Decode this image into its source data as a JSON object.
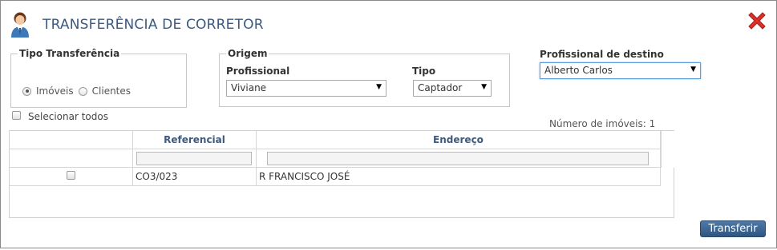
{
  "title": "TRANSFERÊNCIA DE CORRETOR",
  "tipo_transferencia": {
    "legend": "Tipo Transferência",
    "options": [
      "Imóveis",
      "Clientes"
    ],
    "selected": "Imóveis"
  },
  "origem": {
    "legend": "Origem",
    "profissional_label": "Profissional",
    "profissional_value": "Viviane",
    "tipo_label": "Tipo",
    "tipo_value": "Captador"
  },
  "destino": {
    "label": "Profissional de destino",
    "value": "Alberto Carlos"
  },
  "selecionar_todos": "Selecionar todos",
  "count_text": "Número de imóveis: 1",
  "grid": {
    "columns": [
      "Referencial",
      "Endereço"
    ],
    "rows": [
      {
        "referencial": "CO3/023",
        "endereco": "R FRANCISCO JOSÉ"
      }
    ]
  },
  "buttons": {
    "transferir": "Transferir"
  },
  "colors": {
    "accent": "#3c5a7f",
    "close": "#d9302a",
    "button": "#2f5580"
  }
}
